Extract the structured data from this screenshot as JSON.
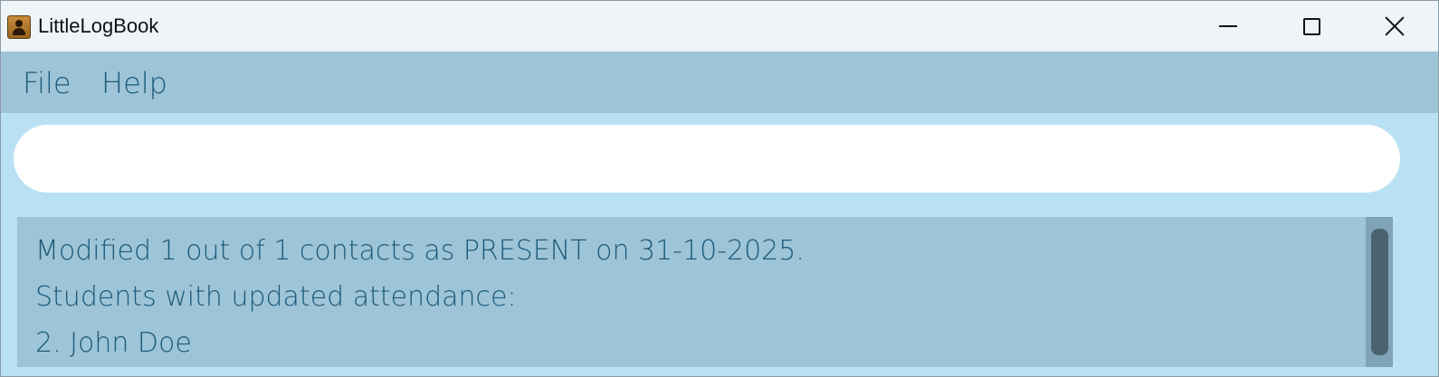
{
  "window": {
    "title": "LittleLogBook",
    "app_icon": "address-book-icon",
    "controls": [
      "minimize-icon",
      "maximize-icon",
      "close-icon"
    ]
  },
  "menu": {
    "file_label": "File",
    "help_label": "Help"
  },
  "command": {
    "value": "",
    "placeholder": ""
  },
  "result": {
    "lines": [
      "Modified 1 out of 1 contacts as PRESENT on 31-10-2025.",
      "Students with updated attendance:",
      "2. John Doe"
    ]
  },
  "colors": {
    "titlebar_bg": "#eef4f8",
    "menubar_bg": "#9ec4d7",
    "window_bg": "#b9e1f3",
    "text_accent": "#1c5a7a",
    "scroll_thumb": "#4a6472"
  }
}
